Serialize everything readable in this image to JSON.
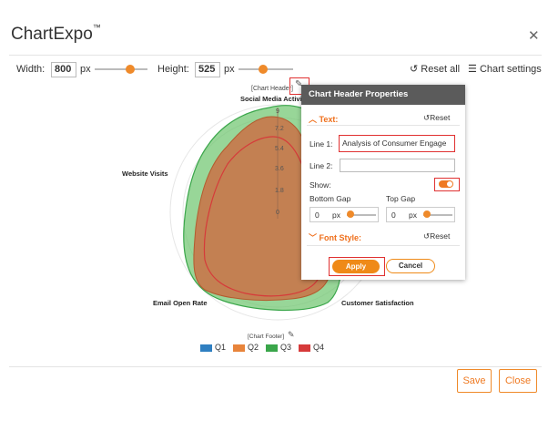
{
  "app": {
    "title": "ChartExpo",
    "trademark": "™"
  },
  "toolbar": {
    "width_label": "Width:",
    "width_value": "800",
    "width_unit": "px",
    "height_label": "Height:",
    "height_value": "525",
    "height_unit": "px",
    "reset_all": "Reset all",
    "chart_settings": "Chart settings"
  },
  "chart": {
    "header_placeholder": "[Chart Header]",
    "footer_placeholder": "[Chart Footer]",
    "axes": [
      "Social Media Activi",
      "Website Visits",
      "Email Open Rate",
      "Customer Satisfaction"
    ],
    "ticks": [
      "9",
      "7.2",
      "5.4",
      "3.6",
      "1.8",
      "0"
    ],
    "legend": [
      {
        "label": "Q1",
        "color": "#2f7fc1"
      },
      {
        "label": "Q2",
        "color": "#e8843b"
      },
      {
        "label": "Q3",
        "color": "#3aa64a"
      },
      {
        "label": "Q4",
        "color": "#d63a3a"
      }
    ]
  },
  "panel": {
    "title": "Chart Header Properties",
    "text_section": "Text:",
    "reset": "Reset",
    "line1_label": "Line 1:",
    "line1_value": "Analysis of Consumer Engage",
    "line2_label": "Line 2:",
    "line2_value": "",
    "show_label": "Show:",
    "bottom_gap_label": "Bottom Gap",
    "bottom_gap_value": "0",
    "top_gap_label": "Top Gap",
    "top_gap_value": "0",
    "unit": "px",
    "font_style_section": "Font Style:",
    "reset2": "Reset",
    "apply": "Apply",
    "cancel": "Cancel"
  },
  "footer": {
    "save": "Save",
    "close": "Close"
  },
  "colors": {
    "accent": "#ef8a2a",
    "highlight": "#e03131",
    "panel_header": "#5b5b5b"
  }
}
